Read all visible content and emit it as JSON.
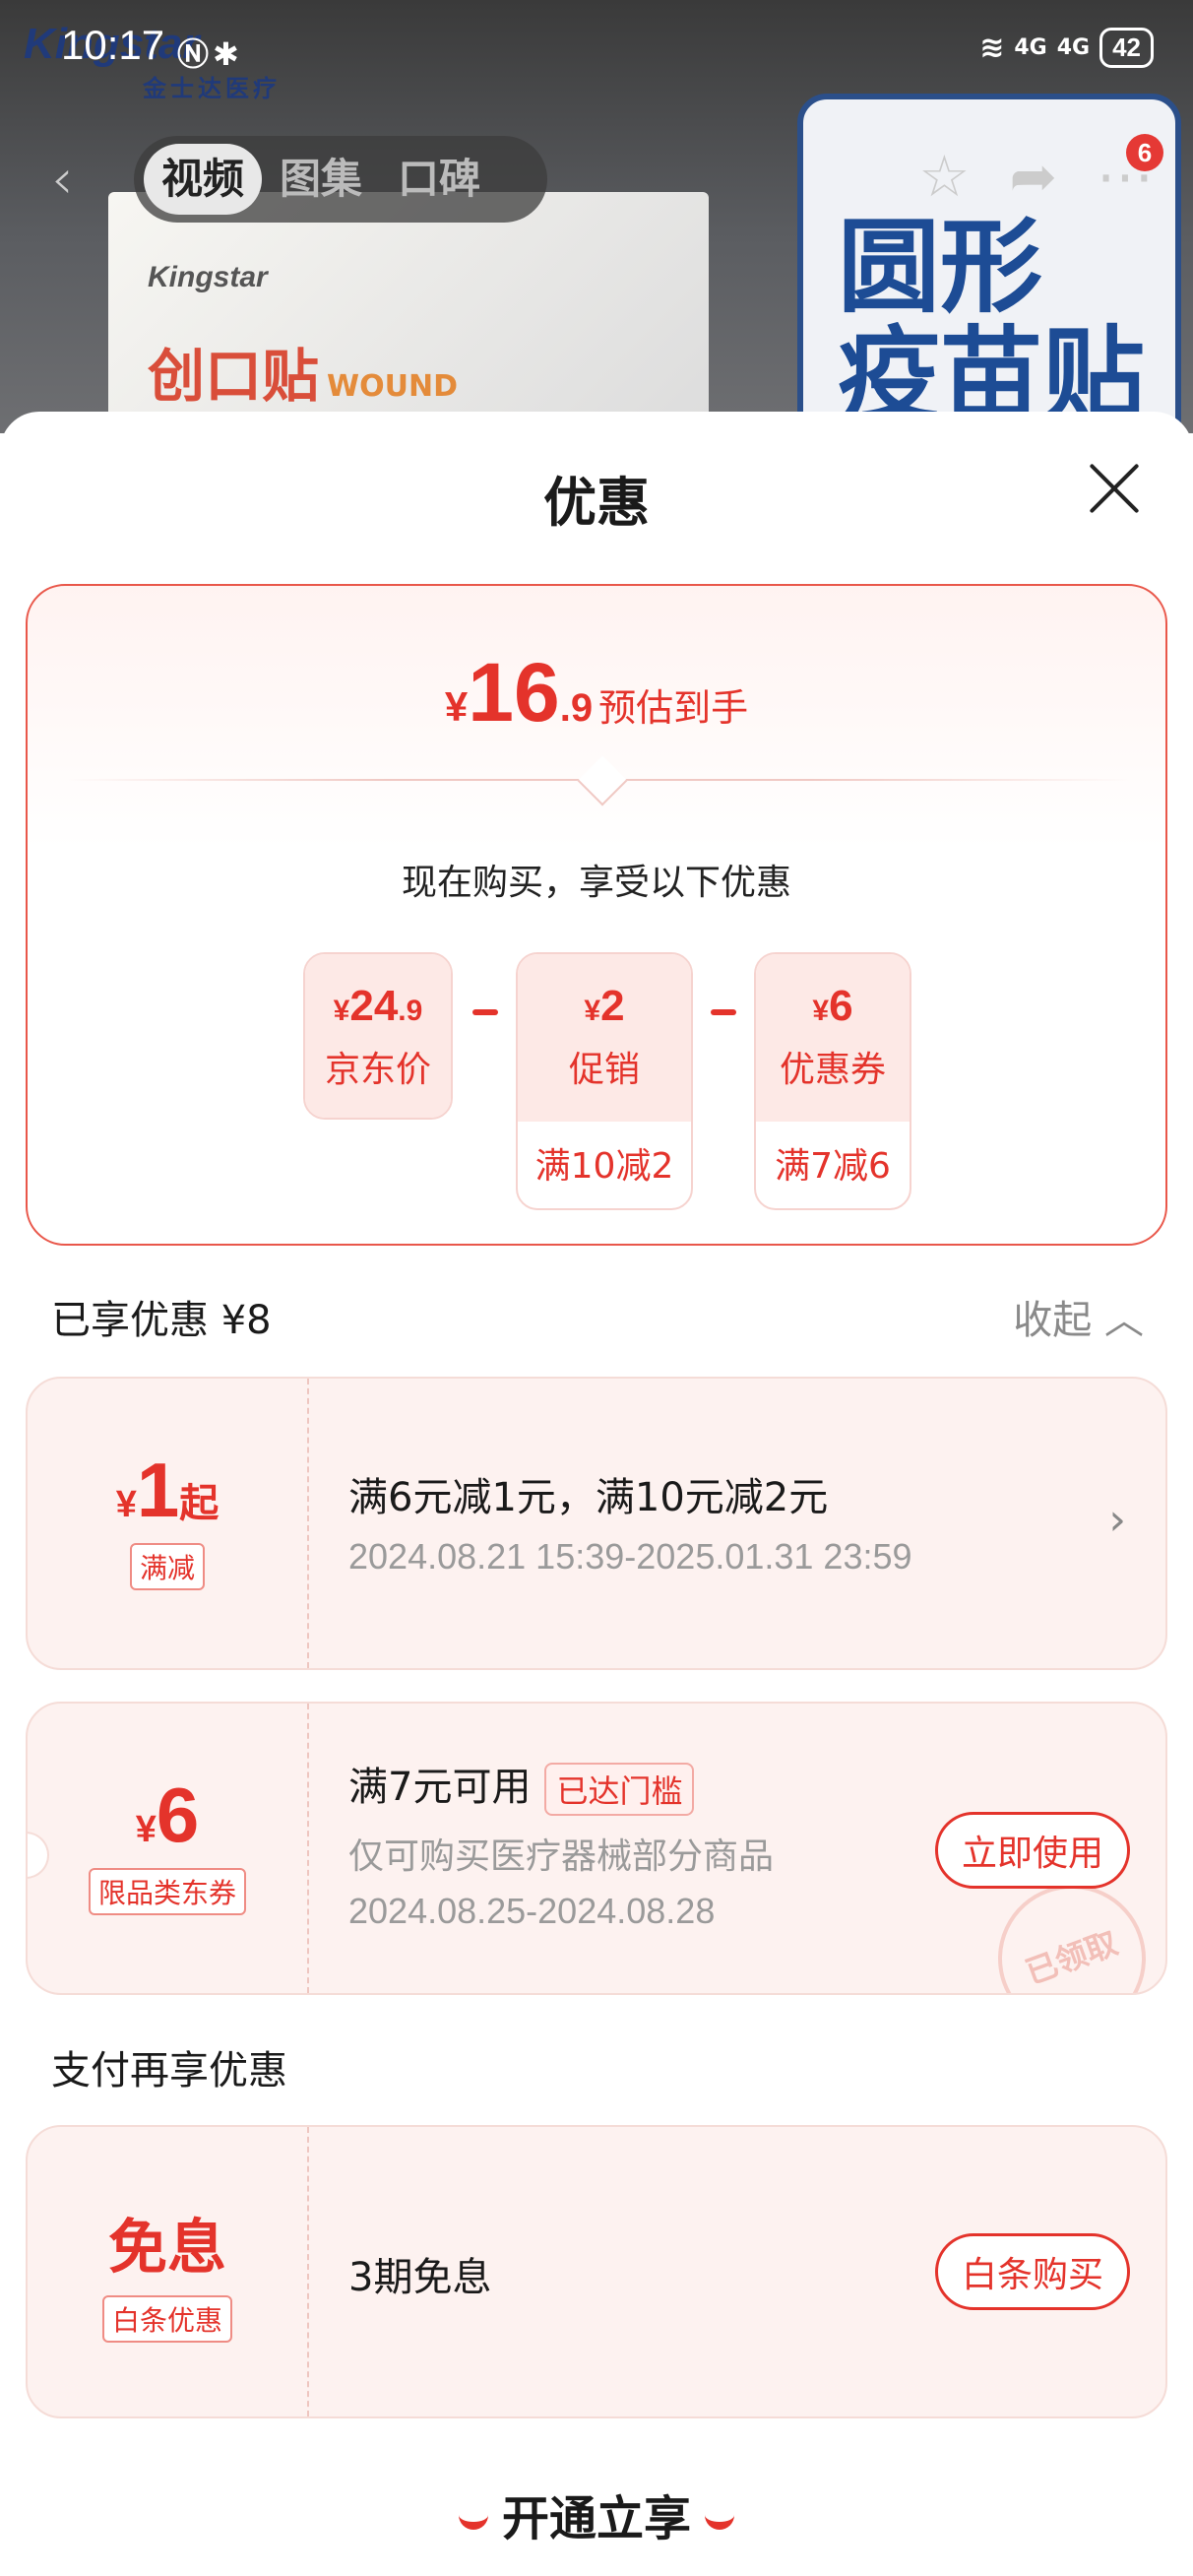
{
  "status_bar": {
    "time": "10:17",
    "battery": "42",
    "signal1": "4G",
    "signal2": "4G"
  },
  "background": {
    "logo": "Kingstar",
    "logo_sub": "金士达医疗",
    "product_brand": "Kingstar",
    "product_name": "创口贴",
    "product_en": "WOUND",
    "card_line1": "圆形",
    "card_line2": "疫苗贴"
  },
  "header": {
    "tabs": [
      {
        "label": "视频",
        "active": true
      },
      {
        "label": "图集",
        "active": false
      },
      {
        "label": "口碑",
        "active": false
      }
    ],
    "cart_badge": "6"
  },
  "sheet": {
    "title": "优惠",
    "estimate": {
      "currency": "¥",
      "price_int": "16",
      "price_dec": ".9",
      "label": "预估到手",
      "subtitle": "现在购买，享受以下优惠",
      "items": [
        {
          "currency": "¥",
          "amount": "24",
          "decimal": ".9",
          "name": "京东价",
          "condition": ""
        },
        {
          "currency": "¥",
          "amount": "2",
          "decimal": "",
          "name": "促销",
          "condition": "满10减2"
        },
        {
          "currency": "¥",
          "amount": "6",
          "decimal": "",
          "name": "优惠券",
          "condition": "满7减6"
        }
      ]
    },
    "enjoyed": {
      "title": "已享优惠 ¥8",
      "collapse_label": "收起 ︿"
    },
    "coupons": [
      {
        "currency": "¥",
        "amount": "1",
        "suffix": "起",
        "tag": "满减",
        "title": "满6元减1元，满10元减2元",
        "line2": "2024.08.21 15:39-2025.01.31 23:59"
      },
      {
        "currency": "¥",
        "amount": "6",
        "suffix": "",
        "tag": "限品类东券",
        "title": "满7元可用",
        "badge": "已达门槛",
        "line2": "仅可购买医疗器械部分商品",
        "line3": "2024.08.25-2024.08.28",
        "action": "立即使用",
        "stamp": "已领取"
      }
    ],
    "payment": {
      "title": "支付再享优惠",
      "big": "免息",
      "tag": "白条优惠",
      "desc": "3期免息",
      "action": "白条购买"
    },
    "bottom_cta": "开通立享"
  }
}
